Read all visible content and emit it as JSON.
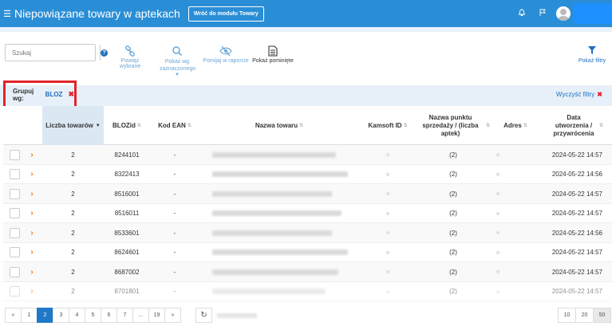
{
  "header": {
    "menu_icon": "hamburger-icon",
    "title": "Niepowiązane towary w aptekach",
    "back_button": "Wróć do modułu Towary",
    "icons": [
      "bell-icon",
      "flag-icon",
      "user-avatar-icon"
    ]
  },
  "toolbar": {
    "search_placeholder": "Szukaj",
    "help_icon": "question-icon",
    "actions": [
      {
        "label": "Powiąż wybrane",
        "icon": "link-icon",
        "active": false
      },
      {
        "label": "Pokaż wg zaznaczonego",
        "icon": "search-icon",
        "active": false
      },
      {
        "label": "Pomijaj w raporcie",
        "icon": "eye-slash-icon",
        "active": false
      },
      {
        "label": "Pokaż pominięte",
        "icon": "document-icon",
        "active": true
      }
    ],
    "filter_label": "Pokaż filtry",
    "filter_icon": "funnel-icon"
  },
  "filterbar": {
    "group_label": "Grupuj wg:",
    "group_value": "BLOZ",
    "clear_label": "Wyczyść filtry"
  },
  "table": {
    "columns": [
      "Liczba towarów",
      "BLOZid",
      "Kod EAN",
      "Nazwa towaru",
      "Kamsoft ID",
      "Nazwa punktu sprzedaży / (liczba aptek)",
      "Adres",
      "Data utworzenia / przywrócenia"
    ],
    "rows": [
      {
        "count": "2",
        "bloz": "8244101",
        "ean": "-",
        "pos": "(2)",
        "date": "2024-05-22 14:57"
      },
      {
        "count": "2",
        "bloz": "8322413",
        "ean": "-",
        "pos": "(2)",
        "date": "2024-05-22 14:56"
      },
      {
        "count": "2",
        "bloz": "8516001",
        "ean": "-",
        "pos": "(2)",
        "date": "2024-05-22 14:57"
      },
      {
        "count": "2",
        "bloz": "8516011",
        "ean": "-",
        "pos": "(2)",
        "date": "2024-05-22 14:57"
      },
      {
        "count": "2",
        "bloz": "8533601",
        "ean": "-",
        "pos": "(2)",
        "date": "2024-05-22 14:56"
      },
      {
        "count": "2",
        "bloz": "8624601",
        "ean": "-",
        "pos": "(2)",
        "date": "2024-05-22 14:57"
      },
      {
        "count": "2",
        "bloz": "8687002",
        "ean": "-",
        "pos": "(2)",
        "date": "2024-05-22 14:57"
      },
      {
        "count": "2",
        "bloz": "8701801",
        "ean": "-",
        "pos": "(2)",
        "date": "2024-05-22 14:57"
      }
    ]
  },
  "pagination": {
    "pages": [
      "«",
      "1",
      "2",
      "3",
      "4",
      "5",
      "6",
      "7",
      "...",
      "19",
      "»"
    ],
    "active_page": "2",
    "page_sizes": [
      "10",
      "20",
      "50"
    ],
    "active_size": "50"
  },
  "colors": {
    "accent": "#2a8ed6",
    "highlight_border": "#e2232a",
    "caret": "#f07a1a"
  }
}
